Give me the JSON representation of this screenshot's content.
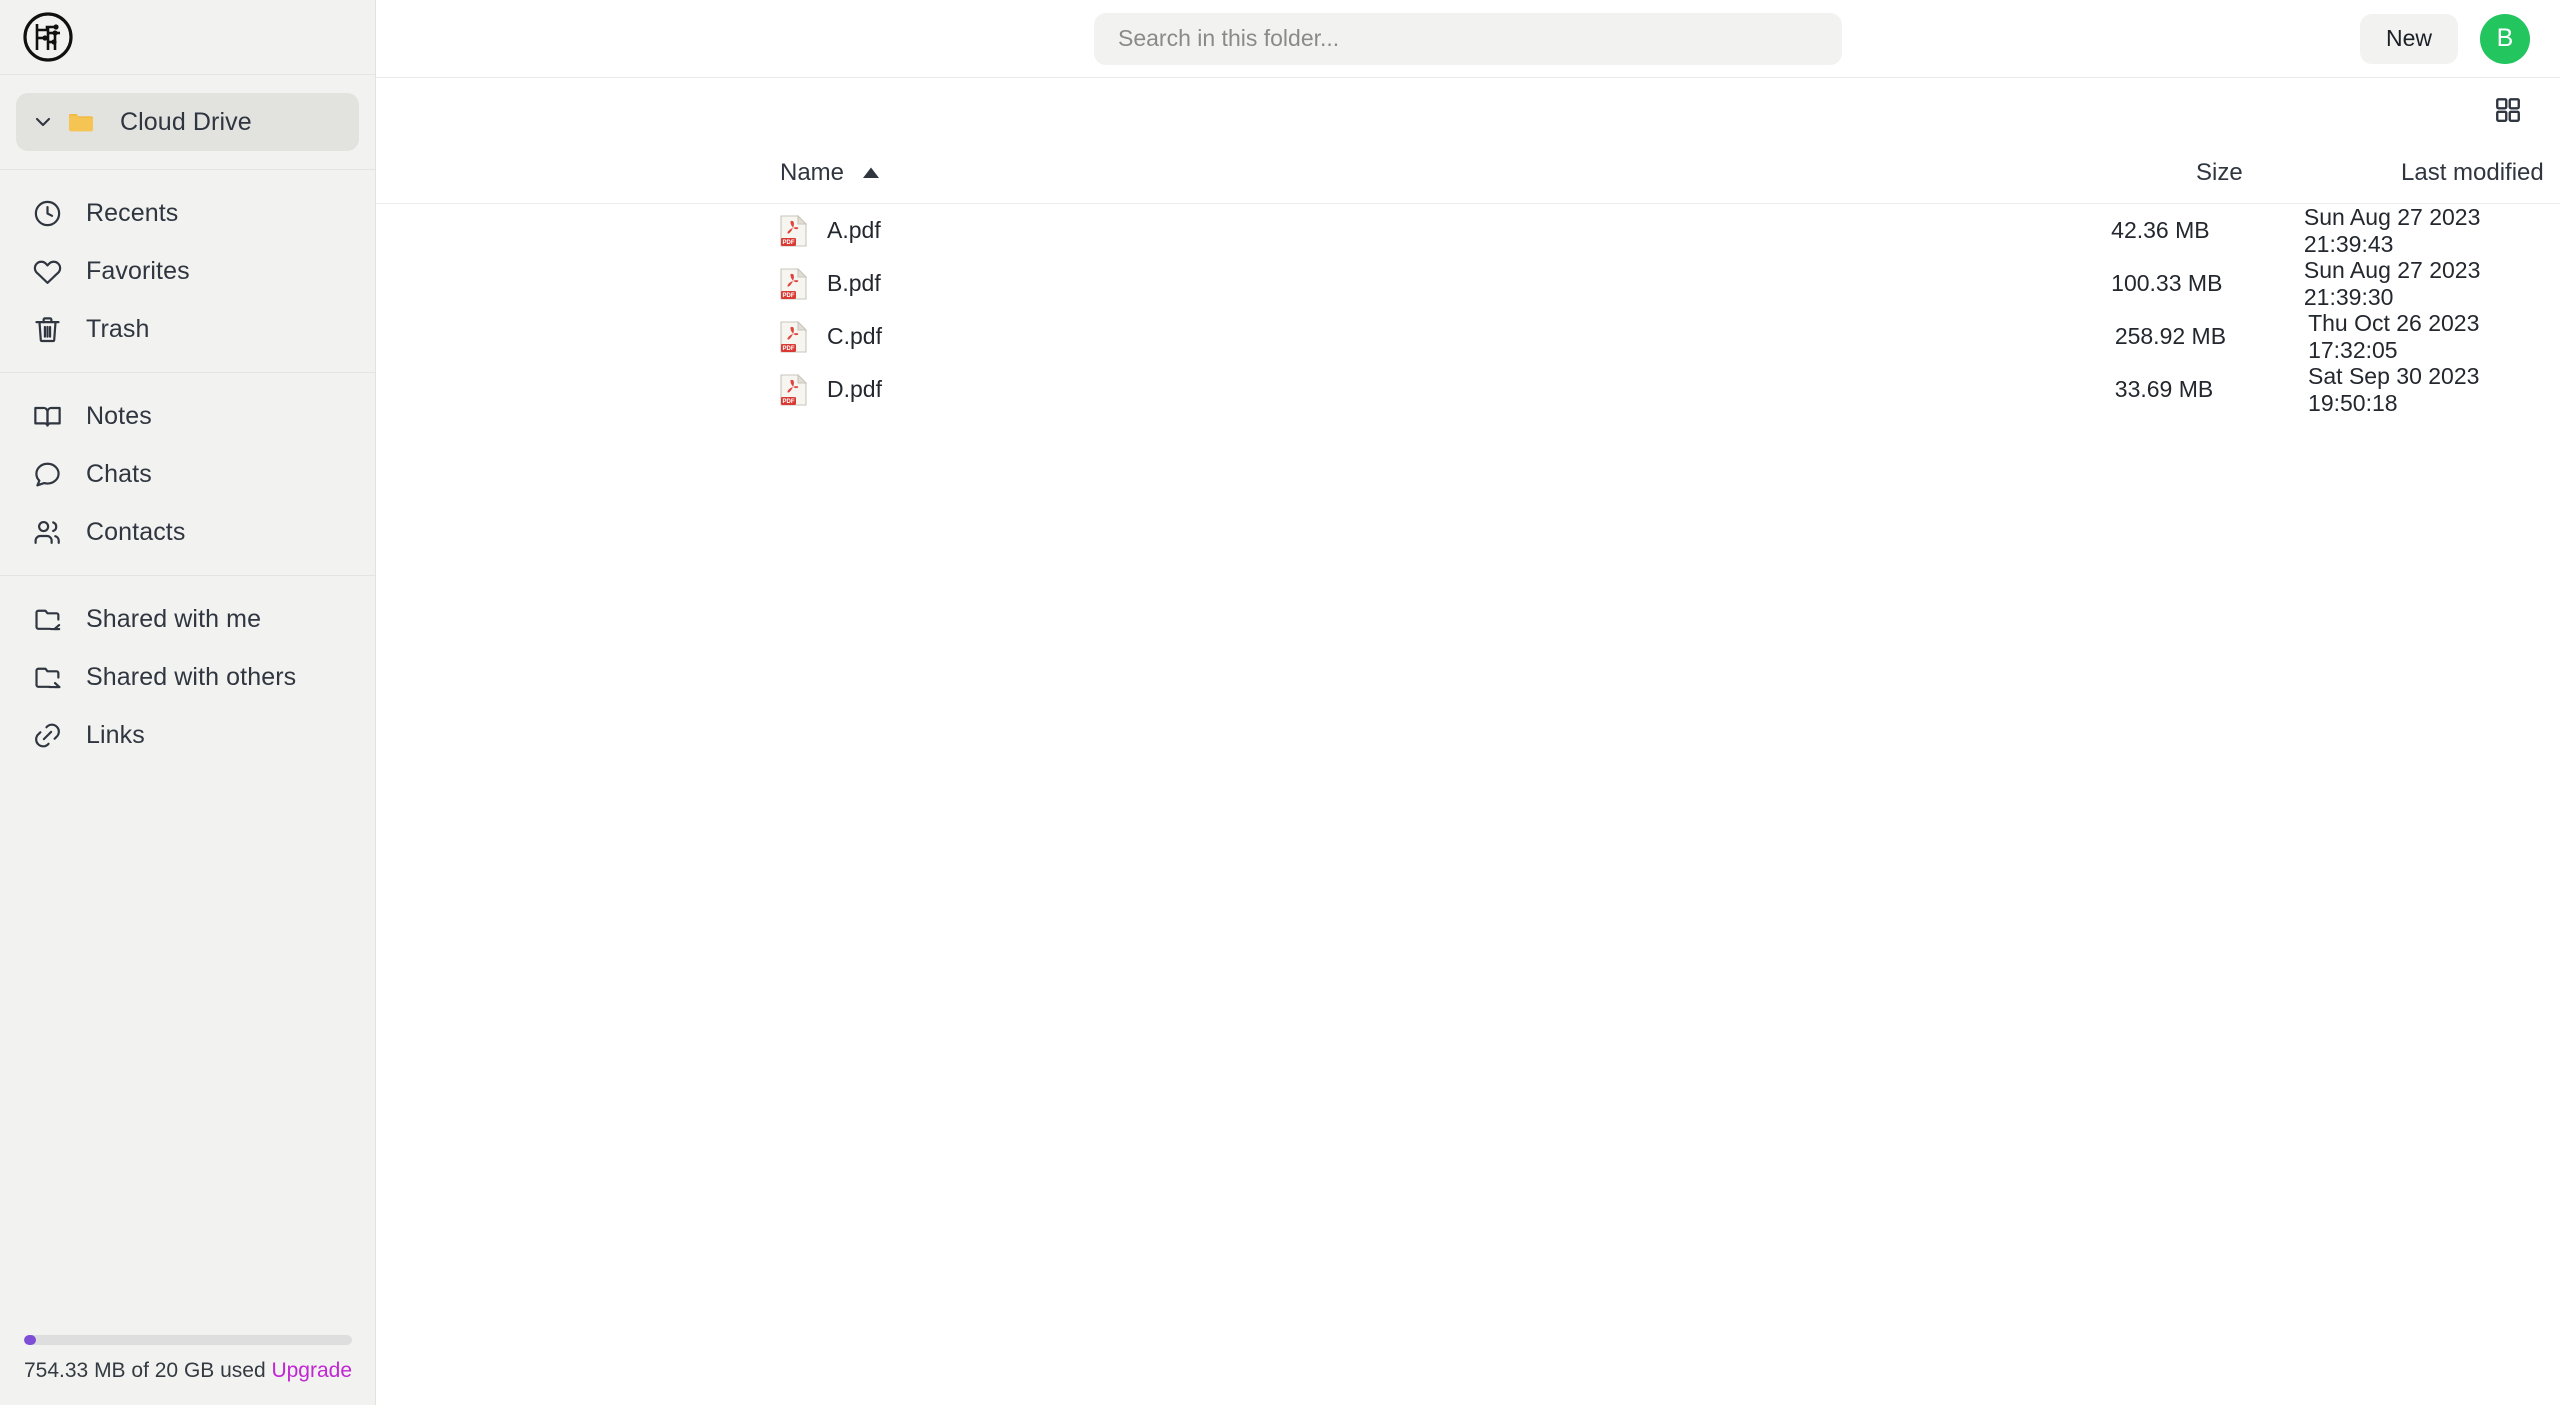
{
  "app": {
    "logo_name": "fileturtle-logo"
  },
  "sidebar": {
    "root": {
      "label": "Cloud Drive",
      "folder_icon": "folder-icon",
      "chevron_icon": "chevron-down-icon"
    },
    "groups": [
      {
        "items": [
          {
            "label": "Recents",
            "icon": "clock-icon"
          },
          {
            "label": "Favorites",
            "icon": "heart-icon"
          },
          {
            "label": "Trash",
            "icon": "trash-icon"
          }
        ]
      },
      {
        "items": [
          {
            "label": "Notes",
            "icon": "book-icon"
          },
          {
            "label": "Chats",
            "icon": "chat-bubble-icon"
          },
          {
            "label": "Contacts",
            "icon": "users-icon"
          }
        ]
      },
      {
        "items": [
          {
            "label": "Shared with me",
            "icon": "folder-in-icon"
          },
          {
            "label": "Shared with others",
            "icon": "folder-out-icon"
          },
          {
            "label": "Links",
            "icon": "link-icon"
          }
        ]
      }
    ],
    "storage": {
      "text": "754.33 MB of 20 GB used",
      "upgrade_label": "Upgrade",
      "percent": 3.7,
      "fill_color": "#7e4fd6",
      "track_color": "#dedede",
      "upgrade_color": "#c026d3"
    }
  },
  "topbar": {
    "search_placeholder": "Search in this folder...",
    "search_value": "",
    "new_label": "New",
    "avatar_initial": "B",
    "avatar_color": "#22c55e",
    "view_toggle_icon": "grid-view-icon"
  },
  "table": {
    "columns": {
      "name": "Name",
      "size": "Size",
      "modified": "Last modified"
    },
    "sort": {
      "column": "Name",
      "direction": "asc",
      "icon": "sort-ascending-icon"
    },
    "rows": [
      {
        "name": "A.pdf",
        "icon": "pdf-file-icon",
        "size": "42.36 MB",
        "modified": "Sun Aug 27 2023 21:39:43"
      },
      {
        "name": "B.pdf",
        "icon": "pdf-file-icon",
        "size": "100.33 MB",
        "modified": "Sun Aug 27 2023 21:39:30"
      },
      {
        "name": "C.pdf",
        "icon": "pdf-file-icon",
        "size": "258.92 MB",
        "modified": "Thu Oct 26 2023 17:32:05"
      },
      {
        "name": "D.pdf",
        "icon": "pdf-file-icon",
        "size": "33.69 MB",
        "modified": "Sat Sep 30 2023 19:50:18"
      }
    ]
  }
}
